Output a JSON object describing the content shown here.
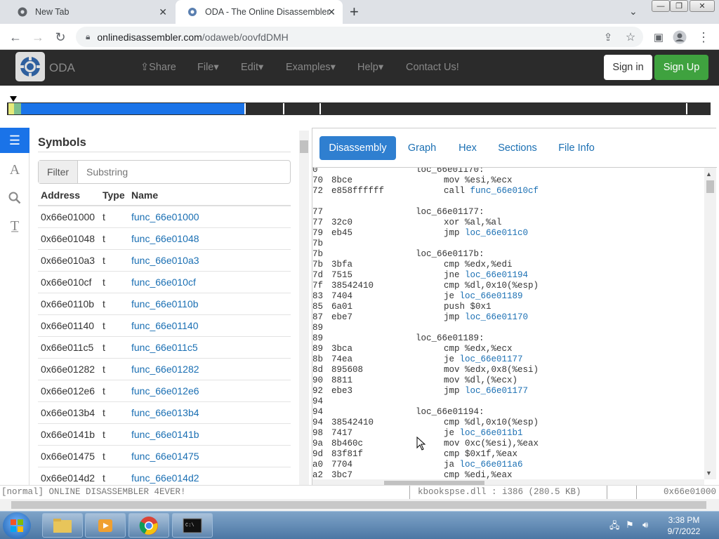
{
  "browser": {
    "tabs": [
      {
        "title": "New Tab",
        "icon": "chrome-icon"
      },
      {
        "title": "ODA - The Online Disassembler",
        "icon": "oda-favicon"
      }
    ],
    "url_domain": "onlinedisassembler.com",
    "url_path": "/odaweb/oovfdDMH"
  },
  "oda_nav": {
    "brand": "ODA",
    "items": [
      "Share",
      "File",
      "Edit",
      "Examples",
      "Help",
      "Contact Us!"
    ],
    "signin": "Sign in",
    "signup": "Sign Up",
    "colors": {
      "signup": "#3fa23f",
      "accent": "#1a73e8"
    }
  },
  "symbols": {
    "title": "Symbols",
    "filter_label": "Filter",
    "filter_placeholder": "Substring",
    "headers": {
      "address": "Address",
      "type": "Type",
      "name": "Name"
    },
    "rows": [
      {
        "address": "0x66e01000",
        "type": "t",
        "name": "func_66e01000"
      },
      {
        "address": "0x66e01048",
        "type": "t",
        "name": "func_66e01048"
      },
      {
        "address": "0x66e010a3",
        "type": "t",
        "name": "func_66e010a3"
      },
      {
        "address": "0x66e010cf",
        "type": "t",
        "name": "func_66e010cf"
      },
      {
        "address": "0x66e0110b",
        "type": "t",
        "name": "func_66e0110b"
      },
      {
        "address": "0x66e01140",
        "type": "t",
        "name": "func_66e01140"
      },
      {
        "address": "0x66e011c5",
        "type": "t",
        "name": "func_66e011c5"
      },
      {
        "address": "0x66e01282",
        "type": "t",
        "name": "func_66e01282"
      },
      {
        "address": "0x66e012e6",
        "type": "t",
        "name": "func_66e012e6"
      },
      {
        "address": "0x66e013b4",
        "type": "t",
        "name": "func_66e013b4"
      },
      {
        "address": "0x66e0141b",
        "type": "t",
        "name": "func_66e0141b"
      },
      {
        "address": "0x66e01475",
        "type": "t",
        "name": "func_66e01475"
      },
      {
        "address": "0x66e014d2",
        "type": "t",
        "name": "func_66e014d2"
      }
    ]
  },
  "right_tabs": [
    "Disassembly",
    "Graph",
    "Hex",
    "Sections",
    "File Info"
  ],
  "disasm": [
    {
      "a": "0",
      "b": "",
      "lbl": "loc_66e01170:",
      "m": ""
    },
    {
      "a": "70",
      "b": "8bce",
      "lbl": "",
      "m": "mov %esi,%ecx"
    },
    {
      "a": "72",
      "b": "e858ffffff",
      "lbl": "",
      "m": "call ",
      "link": "func_66e010cf"
    },
    {
      "a": "",
      "b": "",
      "lbl": "",
      "m": ""
    },
    {
      "a": "77",
      "b": "",
      "lbl": "loc_66e01177:",
      "m": ""
    },
    {
      "a": "77",
      "b": "32c0",
      "lbl": "",
      "m": "xor %al,%al"
    },
    {
      "a": "79",
      "b": "eb45",
      "lbl": "",
      "m": "jmp ",
      "link": "loc_66e011c0"
    },
    {
      "a": "7b",
      "b": "",
      "lbl": "",
      "m": ""
    },
    {
      "a": "7b",
      "b": "",
      "lbl": "loc_66e0117b:",
      "m": ""
    },
    {
      "a": "7b",
      "b": "3bfa",
      "lbl": "",
      "m": "cmp %edx,%edi"
    },
    {
      "a": "7d",
      "b": "7515",
      "lbl": "",
      "m": "jne ",
      "link": "loc_66e01194"
    },
    {
      "a": "7f",
      "b": "38542410",
      "lbl": "",
      "m": "cmp %dl,0x10(%esp)"
    },
    {
      "a": "83",
      "b": "7404",
      "lbl": "",
      "m": "je ",
      "link": "loc_66e01189"
    },
    {
      "a": "85",
      "b": "6a01",
      "lbl": "",
      "m": "push $0x1"
    },
    {
      "a": "87",
      "b": "ebe7",
      "lbl": "",
      "m": "jmp ",
      "link": "loc_66e01170"
    },
    {
      "a": "89",
      "b": "",
      "lbl": "",
      "m": ""
    },
    {
      "a": "89",
      "b": "",
      "lbl": "loc_66e01189:",
      "m": ""
    },
    {
      "a": "89",
      "b": "3bca",
      "lbl": "",
      "m": "cmp %edx,%ecx"
    },
    {
      "a": "8b",
      "b": "74ea",
      "lbl": "",
      "m": "je ",
      "link": "loc_66e01177"
    },
    {
      "a": "8d",
      "b": "895608",
      "lbl": "",
      "m": "mov %edx,0x8(%esi)"
    },
    {
      "a": "90",
      "b": "8811",
      "lbl": "",
      "m": "mov %dl,(%ecx)"
    },
    {
      "a": "92",
      "b": "ebe3",
      "lbl": "",
      "m": "jmp ",
      "link": "loc_66e01177"
    },
    {
      "a": "94",
      "b": "",
      "lbl": "",
      "m": ""
    },
    {
      "a": "94",
      "b": "",
      "lbl": "loc_66e01194:",
      "m": ""
    },
    {
      "a": "94",
      "b": "38542410",
      "lbl": "",
      "m": "cmp %dl,0x10(%esp)"
    },
    {
      "a": "98",
      "b": "7417",
      "lbl": "",
      "m": "je ",
      "link": "loc_66e011b1"
    },
    {
      "a": "9a",
      "b": "8b460c",
      "lbl": "",
      "m": "mov 0xc(%esi),%eax"
    },
    {
      "a": "9d",
      "b": "83f81f",
      "lbl": "",
      "m": "cmp $0x1f,%eax"
    },
    {
      "a": "a0",
      "b": "7704",
      "lbl": "",
      "m": "ja ",
      "link": "loc_66e011a6"
    },
    {
      "a": "a2",
      "b": "3bc7",
      "lbl": "",
      "m": "cmp %edi,%eax"
    }
  ],
  "status": {
    "left": "[normal] ONLINE DISASSEMBLER 4EVER!",
    "file": "kbookspse.dll : i386 (280.5 KB)",
    "addr": "0x66e01000"
  },
  "taskbar": {
    "time": "3:38 PM",
    "date": "9/7/2022"
  }
}
